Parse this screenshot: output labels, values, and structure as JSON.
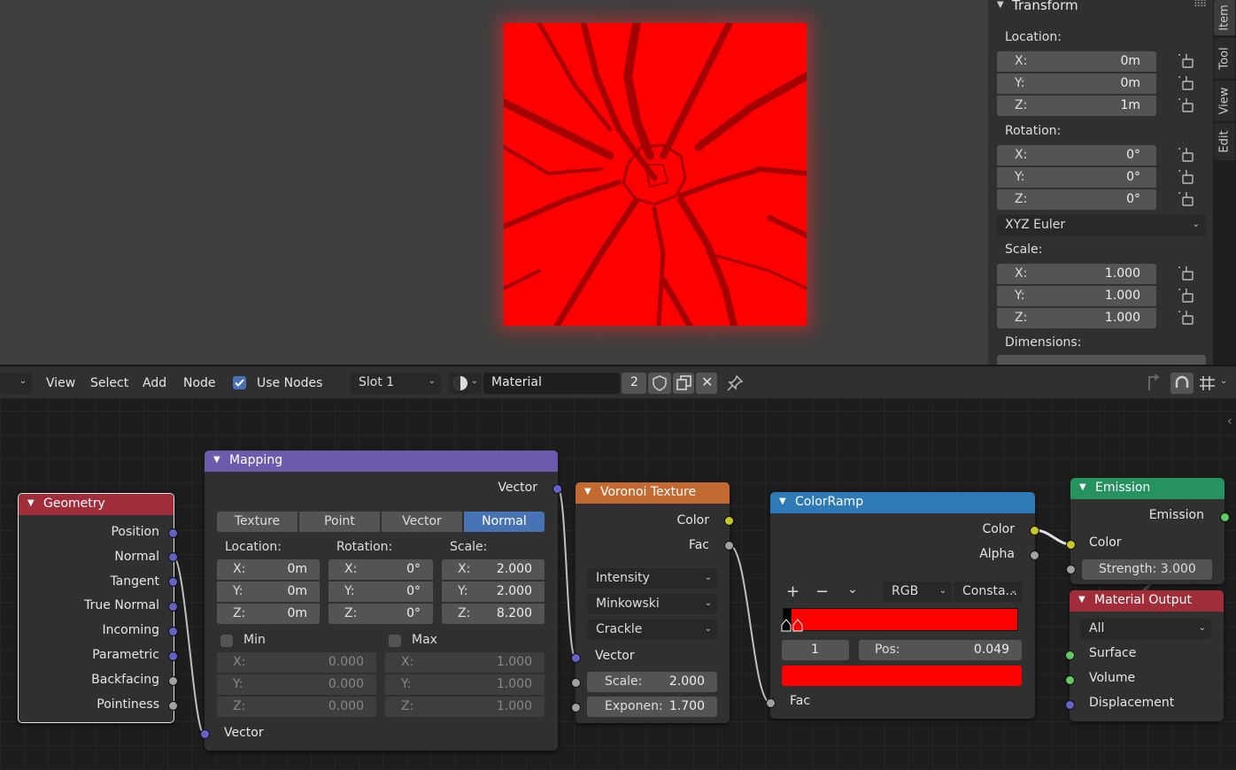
{
  "npanel": {
    "section_title": "Transform",
    "location": {
      "label": "Location:",
      "x": {
        "k": "X:",
        "v": "0m"
      },
      "y": {
        "k": "Y:",
        "v": "0m"
      },
      "z": {
        "k": "Z:",
        "v": "1m"
      }
    },
    "rotation": {
      "label": "Rotation:",
      "x": {
        "k": "X:",
        "v": "0°"
      },
      "y": {
        "k": "Y:",
        "v": "0°"
      },
      "z": {
        "k": "Z:",
        "v": "0°"
      }
    },
    "rotation_mode": "XYZ Euler",
    "scale": {
      "label": "Scale:",
      "x": {
        "k": "X:",
        "v": "1.000"
      },
      "y": {
        "k": "Y:",
        "v": "1.000"
      },
      "z": {
        "k": "Z:",
        "v": "1.000"
      }
    },
    "dimensions_label": "Dimensions:",
    "tabs": [
      "Item",
      "Tool",
      "View",
      "Edit"
    ]
  },
  "header": {
    "menus": [
      "View",
      "Select",
      "Add",
      "Node"
    ],
    "use_nodes_label": "Use Nodes",
    "slot": "Slot 1",
    "material_name": "Material",
    "users": "2"
  },
  "nodes": {
    "geometry": {
      "title": "Geometry",
      "outputs": [
        "Position",
        "Normal",
        "Tangent",
        "True Normal",
        "Incoming",
        "Parametric",
        "Backfacing",
        "Pointiness"
      ]
    },
    "mapping": {
      "title": "Mapping",
      "output": "Vector",
      "types": [
        "Texture",
        "Point",
        "Vector",
        "Normal"
      ],
      "location_label": "Location:",
      "rotation_label": "Rotation:",
      "scale_label": "Scale:",
      "location": [
        {
          "k": "X:",
          "v": "0m"
        },
        {
          "k": "Y:",
          "v": "0m"
        },
        {
          "k": "Z:",
          "v": "0m"
        }
      ],
      "rotation": [
        {
          "k": "X:",
          "v": "0°"
        },
        {
          "k": "Y:",
          "v": "0°"
        },
        {
          "k": "Z:",
          "v": "0°"
        }
      ],
      "scale": [
        {
          "k": "X:",
          "v": "2.000"
        },
        {
          "k": "Y:",
          "v": "2.000"
        },
        {
          "k": "Z:",
          "v": "8.200"
        }
      ],
      "min_label": "Min",
      "max_label": "Max",
      "min": [
        {
          "k": "X:",
          "v": "0.000"
        },
        {
          "k": "Y:",
          "v": "0.000"
        },
        {
          "k": "Z:",
          "v": "0.000"
        }
      ],
      "max": [
        {
          "k": "X:",
          "v": "1.000"
        },
        {
          "k": "Y:",
          "v": "1.000"
        },
        {
          "k": "Z:",
          "v": "1.000"
        }
      ],
      "input": "Vector"
    },
    "voronoi": {
      "title": "Voronoi Texture",
      "outputs": [
        "Color",
        "Fac"
      ],
      "feature": "Intensity",
      "metric": "Minkowski",
      "coloring": "Crackle",
      "input_vector": "Vector",
      "scale": {
        "k": "Scale:",
        "v": "2.000"
      },
      "exponent": {
        "k": "Exponen:",
        "v": "1.700"
      }
    },
    "colorramp": {
      "title": "ColorRamp",
      "outputs": [
        "Color",
        "Alpha"
      ],
      "mode": "RGB",
      "interpolation": "Consta...",
      "index": "1",
      "pos": {
        "k": "Pos:",
        "v": "0.049"
      },
      "input": "Fac",
      "color": "#ff0000"
    },
    "emission": {
      "title": "Emission",
      "output": "Emission",
      "input_color": "Color",
      "strength": "Strength: 3.000"
    },
    "material_output": {
      "title": "Material Output",
      "target": "All",
      "inputs": [
        "Surface",
        "Volume",
        "Displacement"
      ]
    }
  }
}
